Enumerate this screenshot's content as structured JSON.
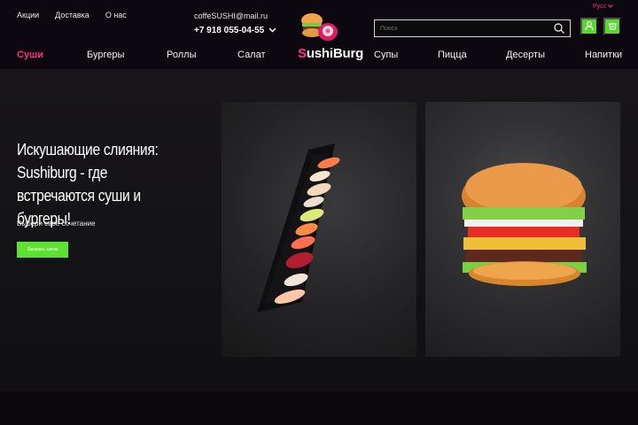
{
  "header": {
    "top_links": [
      "Акции",
      "Доставка",
      "О нас"
    ],
    "email": "coffeSUSHI@mail.ru",
    "phone": "+7 918 055-04-55",
    "brand_first": "S",
    "brand_rest": "ushiBurg",
    "search_placeholder": "Поиск",
    "language": "Русс",
    "accent_color": "#ff2f86",
    "green_color": "#59d92e"
  },
  "nav": {
    "items": [
      "Суши",
      "Бургеры",
      "Роллы",
      "Салат",
      "Супы",
      "Пицца",
      "Десерты",
      "Напитки"
    ]
  },
  "hero": {
    "title": "Искушающие слияния: Sushiburg - где встречаются суши и бургеры!",
    "subtitle": "Выбери свое сочетание",
    "cta": "Заказать меню"
  }
}
